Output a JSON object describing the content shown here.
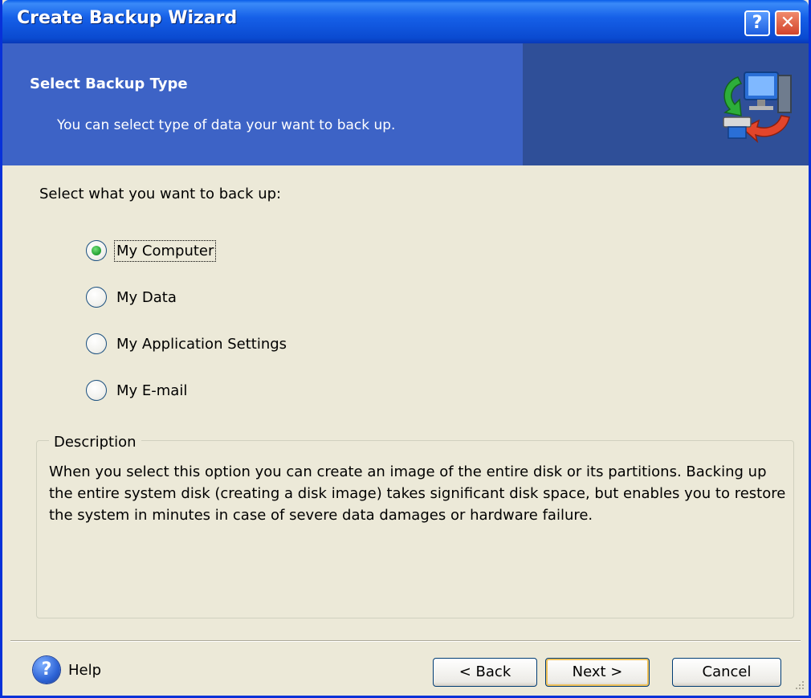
{
  "window": {
    "title": "Create Backup Wizard",
    "help_glyph": "?",
    "close_glyph": "✕"
  },
  "header": {
    "title": "Select Backup Type",
    "subtitle": "You can select type of data your want to back up."
  },
  "main": {
    "prompt": "Select what you want to back up:",
    "options": [
      {
        "label": "My Computer",
        "checked": true
      },
      {
        "label": "My Data",
        "checked": false
      },
      {
        "label": "My Application Settings",
        "checked": false
      },
      {
        "label": "My E-mail",
        "checked": false
      }
    ]
  },
  "description": {
    "legend": "Description",
    "text": "When you select this option you can create an image of the entire disk or its partitions. Backing up the entire system disk (creating a disk image) takes significant disk space, but enables you to restore the system in minutes in case of severe data damages or hardware failure."
  },
  "footer": {
    "help_label": "Help",
    "back_label": "< Back",
    "next_label": "Next >",
    "cancel_label": "Cancel"
  }
}
